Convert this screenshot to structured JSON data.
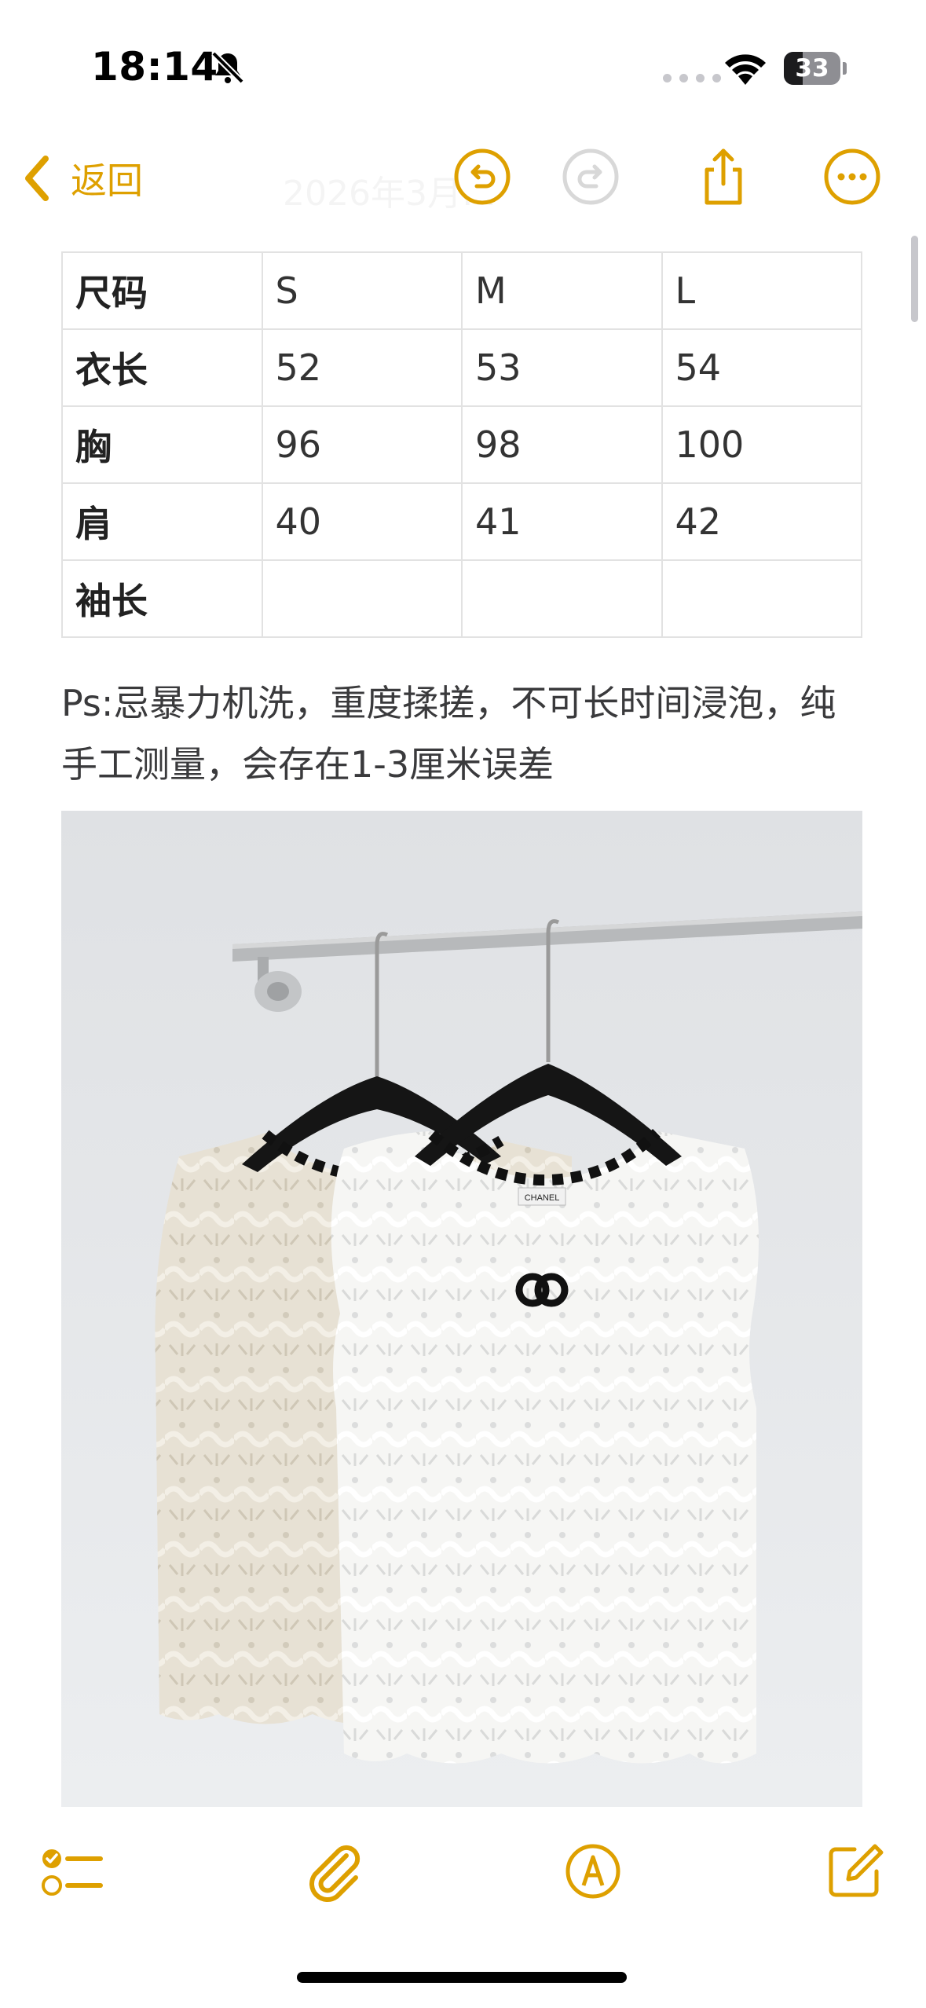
{
  "status_bar": {
    "time": "18:14",
    "silent_icon": "bell-slash-icon",
    "wifi_icon": "wifi-icon",
    "battery_level": "33",
    "battery_fraction": 0.33
  },
  "nav": {
    "back_label": "返回",
    "title": "2026年3月…",
    "icons": [
      "undo-icon",
      "redo-icon",
      "share-icon",
      "more-icon"
    ]
  },
  "colors": {
    "accent": "#dea000",
    "disabled": "#d8d8d8"
  },
  "size_table": {
    "header": [
      "尺码",
      "S",
      "M",
      "L"
    ],
    "rows": [
      [
        "衣长",
        "52",
        "53",
        "54"
      ],
      [
        "胸",
        "96",
        "98",
        "100"
      ],
      [
        "肩",
        "40",
        "41",
        "42"
      ],
      [
        "袖长",
        "",
        "",
        ""
      ]
    ]
  },
  "note": {
    "text": "Ps:忌暴力机洗，重度揉搓，不可长时间浸泡，纯手工测量，会存在1-3厘米误差"
  },
  "photo": {
    "label_on_shirt": "CHANEL"
  },
  "toolbar": {
    "icons": [
      "checklist-icon",
      "paperclip-icon",
      "markup-pen-icon",
      "compose-icon"
    ]
  }
}
